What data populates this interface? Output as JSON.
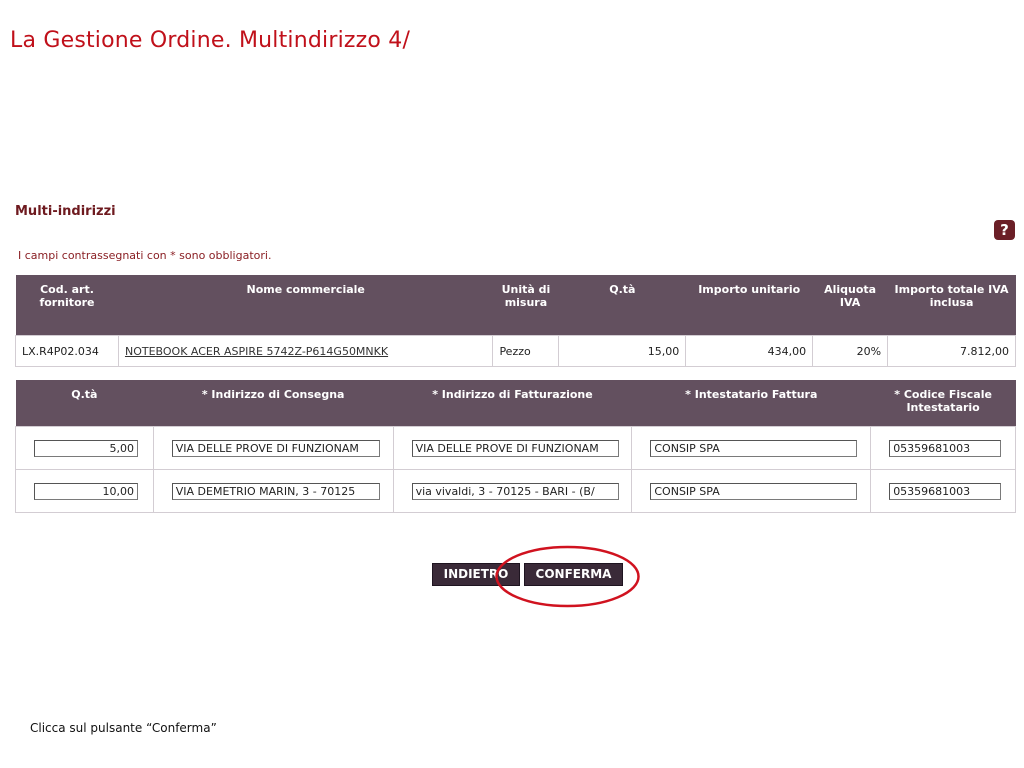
{
  "slide": {
    "title": "La Gestione Ordine. Multindirizzo 4/",
    "instruction": "Clicca sul pulsante “Conferma”"
  },
  "section": {
    "title": "Multi-indirizzi",
    "help_icon_label": "?",
    "required_note": "I campi contrassegnati con * sono obbligatori."
  },
  "items_table": {
    "headers": {
      "code": "Cod. art. fornitore",
      "name": "Nome commerciale",
      "unit": "Unità di misura",
      "qty": "Q.tà",
      "unit_price": "Importo unitario",
      "vat": "Aliquota IVA",
      "total": "Importo totale IVA inclusa"
    },
    "rows": [
      {
        "code": "LX.R4P02.034",
        "name": "NOTEBOOK ACER ASPIRE 5742Z-P614G50MNKK",
        "unit": "Pezzo",
        "qty": "15,00",
        "unit_price": "434,00",
        "vat": "20%",
        "total": "7.812,00"
      }
    ]
  },
  "address_table": {
    "headers": {
      "qty": "Q.tà",
      "delivery": "* Indirizzo di Consegna",
      "billing": "* Indirizzo di Fatturazione",
      "holder": "* Intestatario Fattura",
      "tax_code": "* Codice Fiscale Intestatario"
    },
    "rows": [
      {
        "qty": "5,00",
        "delivery": "VIA DELLE PROVE DI FUNZIONAM",
        "billing": "VIA DELLE PROVE DI FUNZIONAM",
        "holder": "CONSIP SPA",
        "tax_code": "05359681003"
      },
      {
        "qty": "10,00",
        "delivery": "VIA DEMETRIO MARIN, 3 - 70125",
        "billing": "via vivaldi, 3 - 70125 - BARI - (B/",
        "holder": "CONSIP SPA",
        "tax_code": "05359681003"
      }
    ]
  },
  "buttons": {
    "back": "INDIETRO",
    "confirm": "CONFERMA"
  },
  "colors": {
    "header_bg": "#63505f",
    "title_red": "#c0101a",
    "button_bg": "#3a2a38",
    "highlight": "#d0121f"
  }
}
